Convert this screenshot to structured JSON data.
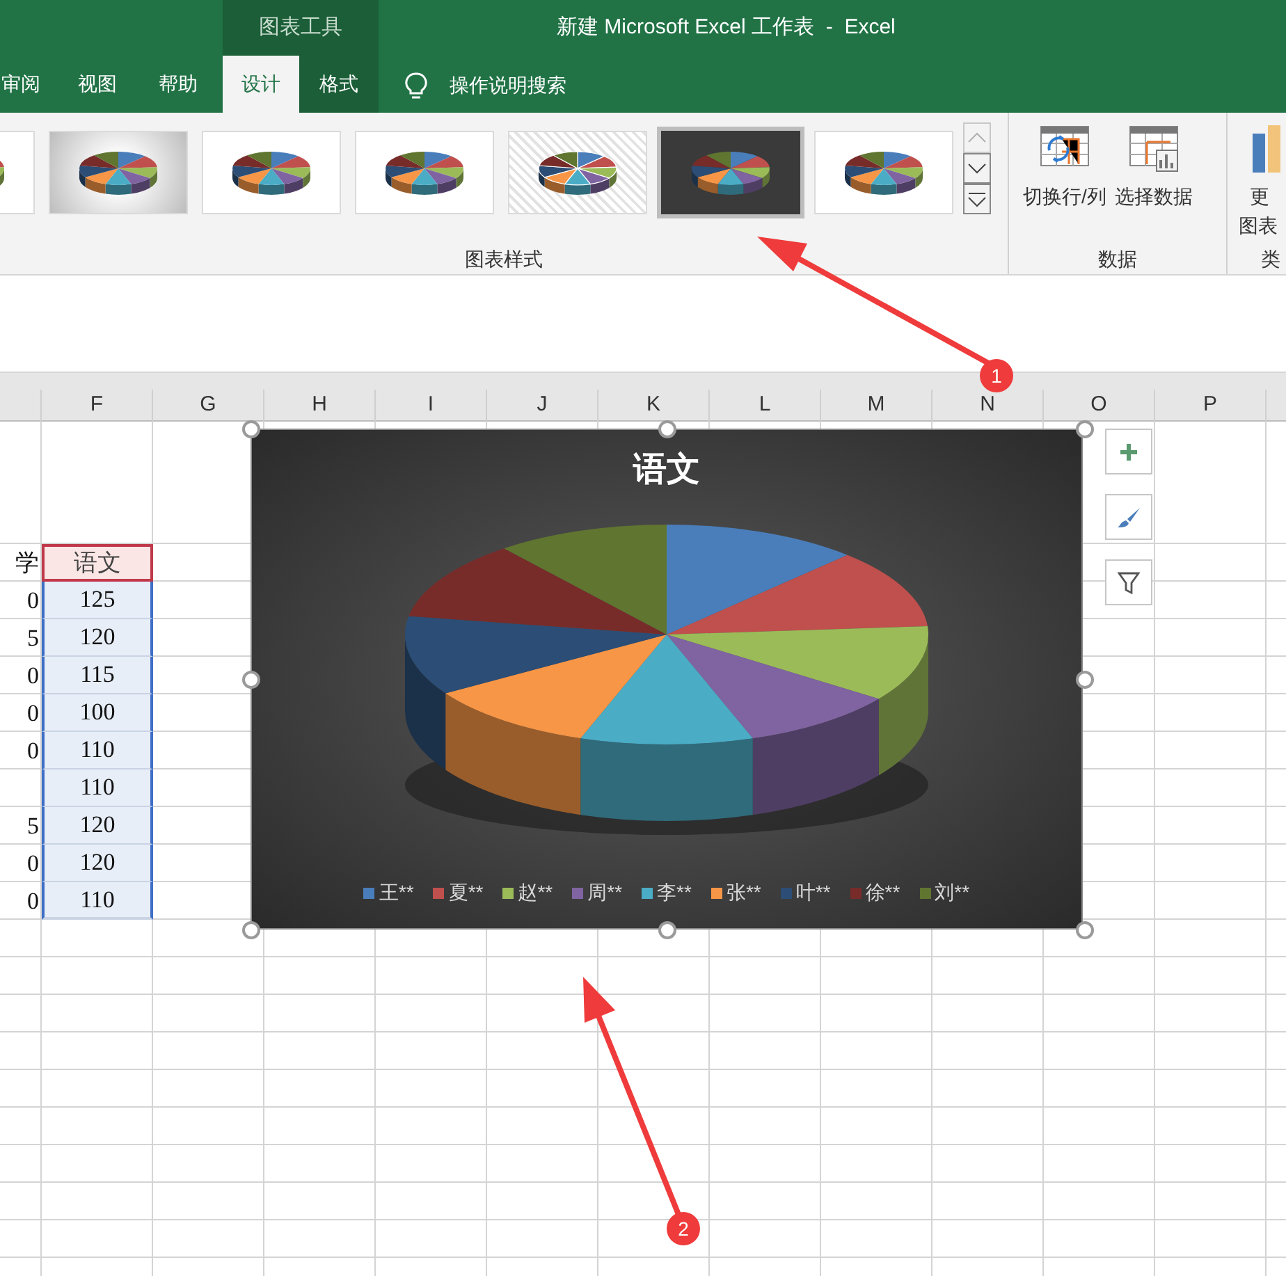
{
  "window": {
    "context_group": "图表工具",
    "title": "新建 Microsoft Excel 工作表  -  Excel"
  },
  "tabs": [
    {
      "label": "审阅",
      "selected": false,
      "contextual": false
    },
    {
      "label": "视图",
      "selected": false,
      "contextual": false
    },
    {
      "label": "帮助",
      "selected": false,
      "contextual": false
    },
    {
      "label": "设计",
      "selected": true,
      "contextual": true
    },
    {
      "label": "格式",
      "selected": false,
      "contextual": true
    }
  ],
  "tell_me": {
    "placeholder": "操作说明搜索"
  },
  "chart_styles": {
    "label": "图表样式",
    "items": [
      {
        "kind": "white",
        "selected": false
      },
      {
        "kind": "gray",
        "selected": false
      },
      {
        "kind": "white",
        "selected": false
      },
      {
        "kind": "white",
        "selected": false
      },
      {
        "kind": "hatched",
        "selected": false
      },
      {
        "kind": "dark",
        "selected": true
      },
      {
        "kind": "white",
        "selected": false
      }
    ]
  },
  "data_group": {
    "label": "数据",
    "buttons": [
      "切换行/列",
      "选择数据"
    ]
  },
  "type_group": {
    "label": "类",
    "button_lines": [
      "更",
      "图表"
    ]
  },
  "sheet": {
    "columns": [
      "F",
      "G",
      "H",
      "I",
      "J",
      "K",
      "L",
      "M",
      "N",
      "O",
      "P"
    ],
    "rows": [
      {
        "kind": "header",
        "col_e": "学",
        "col_f": "语文"
      },
      {
        "kind": "value",
        "col_e": "0",
        "col_f": "125"
      },
      {
        "kind": "value",
        "col_e": "5",
        "col_f": "120"
      },
      {
        "kind": "value",
        "col_e": "0",
        "col_f": "115"
      },
      {
        "kind": "value",
        "col_e": "0",
        "col_f": "100"
      },
      {
        "kind": "value",
        "col_e": "0",
        "col_f": "110"
      },
      {
        "kind": "value",
        "col_f": "110"
      },
      {
        "kind": "value",
        "col_e": "5",
        "col_f": "120"
      },
      {
        "kind": "value",
        "col_e": "0",
        "col_f": "120"
      },
      {
        "kind": "value",
        "col_e": "0",
        "col_f": "110"
      }
    ]
  },
  "chart": {
    "title": "语文",
    "legend": [
      {
        "label": "王**",
        "color": "#4a7ebb"
      },
      {
        "label": "夏**",
        "color": "#c0504d"
      },
      {
        "label": "赵**",
        "color": "#9bbb59"
      },
      {
        "label": "周**",
        "color": "#8064a2"
      },
      {
        "label": "李**",
        "color": "#4bacc6"
      },
      {
        "label": "张**",
        "color": "#f79646"
      },
      {
        "label": "叶**",
        "color": "#2c4d75"
      },
      {
        "label": "徐**",
        "color": "#772c2a"
      },
      {
        "label": "刘**",
        "color": "#5f7530"
      }
    ]
  },
  "annotations": [
    {
      "label": "1"
    },
    {
      "label": "2"
    }
  ]
}
